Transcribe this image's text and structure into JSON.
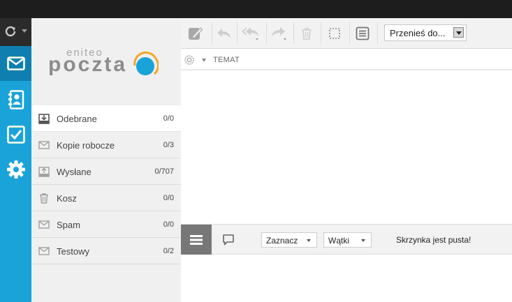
{
  "app": {
    "logo_small": "eniteo",
    "logo_big": "poczta"
  },
  "rail": {
    "items": [
      {
        "name": "mail",
        "icon": "envelope-icon"
      },
      {
        "name": "contacts",
        "icon": "contacts-icon"
      },
      {
        "name": "tasks",
        "icon": "checkbox-icon"
      },
      {
        "name": "settings",
        "icon": "gear-icon"
      }
    ]
  },
  "folders": [
    {
      "name": "Odebrane",
      "count": "0/0",
      "icon": "inbox-icon",
      "active": true
    },
    {
      "name": "Kopie robocze",
      "count": "0/3",
      "icon": "envelope-icon"
    },
    {
      "name": "Wysłane",
      "count": "0/707",
      "icon": "outbox-icon"
    },
    {
      "name": "Kosz",
      "count": "0/0",
      "icon": "trash-icon"
    },
    {
      "name": "Spam",
      "count": "0/0",
      "icon": "envelope-icon"
    },
    {
      "name": "Testowy",
      "count": "0/2",
      "icon": "envelope-icon"
    }
  ],
  "toolbar": {
    "buttons": [
      "compose-icon",
      "reply-icon",
      "reply-all-icon",
      "forward-icon",
      "trash-icon",
      "select-icon",
      "list-icon"
    ],
    "move_label": "Przenieś do..."
  },
  "list_header": {
    "subject_label": "TEMAT"
  },
  "bottombar": {
    "select_label": "Zaznacz",
    "threads_label": "Wątki",
    "empty_message": "Skrzynka jest pusta!"
  },
  "colors": {
    "accent": "#1aa3d9",
    "accent_dark": "#0f7fb0",
    "logo_orange": "#f5a623",
    "topbar": "#1d1d1d"
  }
}
